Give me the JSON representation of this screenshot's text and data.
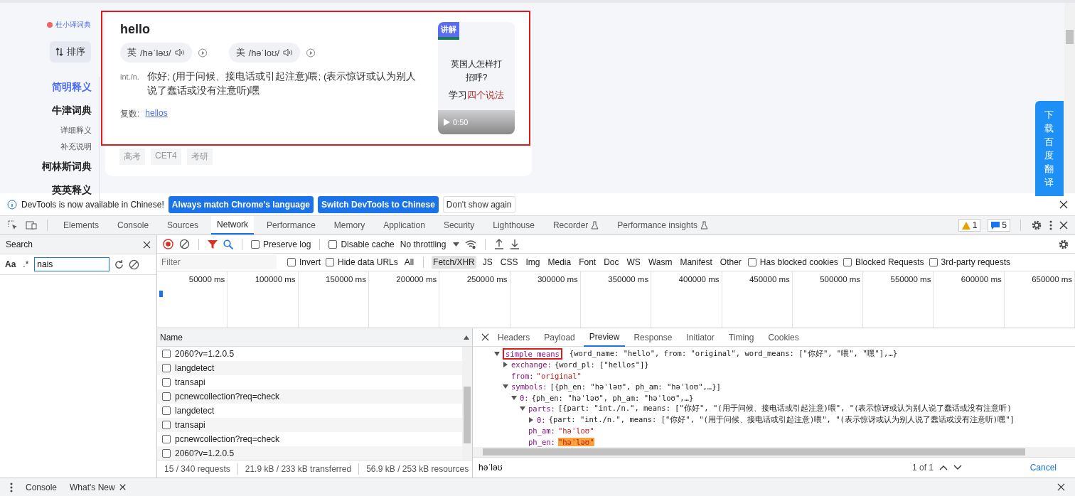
{
  "page": {
    "sidebar": {
      "logo_text": "杜小译词典",
      "sort_button": "排序",
      "nav": [
        {
          "label": "简明释义",
          "selected": true
        },
        {
          "label": "牛津词典",
          "selected": false,
          "children": [
            {
              "label": "详细释义",
              "selected": false
            },
            {
              "label": "补充说明",
              "selected": false
            }
          ]
        },
        {
          "label": "柯林斯词典",
          "selected": false
        },
        {
          "label": "英英释义",
          "selected": false
        }
      ]
    },
    "card": {
      "highlighted": true,
      "word": "hello",
      "pronunciations": [
        {
          "region": "英",
          "ipa": "/həˈləʊ/"
        },
        {
          "region": "美",
          "ipa": "/həˈloʊ/"
        }
      ],
      "definition": {
        "pos": "int./n.",
        "text": "你好;  (用于问候、接电话或引起注意)喂;  (表示惊讶或认为别人说了蠢话或没有注意听)嘿"
      },
      "plural_label": "复数:",
      "plural_link": "hellos",
      "video": {
        "badge": "讲解",
        "title": "英国人怎样打招呼?",
        "subtitle_prefix": "学习",
        "subtitle_highlight": "四个说法",
        "duration": "0:50"
      },
      "tags": [
        "高考",
        "CET4",
        "考研"
      ]
    },
    "download_banner": "下载百度翻译"
  },
  "devtools": {
    "infobar": {
      "message": "DevTools is now available in Chinese!",
      "buttons": [
        {
          "label": "Always match Chrome's language",
          "kind": "primary"
        },
        {
          "label": "Switch DevTools to Chinese",
          "kind": "primary"
        },
        {
          "label": "Don't show again",
          "kind": "plain"
        }
      ]
    },
    "tabs": [
      {
        "label": "Elements",
        "selected": false,
        "experimental": false
      },
      {
        "label": "Console",
        "selected": false,
        "experimental": false
      },
      {
        "label": "Sources",
        "selected": false,
        "experimental": false
      },
      {
        "label": "Network",
        "selected": true,
        "experimental": false
      },
      {
        "label": "Performance",
        "selected": false,
        "experimental": false
      },
      {
        "label": "Memory",
        "selected": false,
        "experimental": false
      },
      {
        "label": "Application",
        "selected": false,
        "experimental": false
      },
      {
        "label": "Security",
        "selected": false,
        "experimental": false
      },
      {
        "label": "Lighthouse",
        "selected": false,
        "experimental": false
      },
      {
        "label": "Recorder",
        "selected": false,
        "experimental": true
      },
      {
        "label": "Performance insights",
        "selected": false,
        "experimental": true
      }
    ],
    "warnings": "1",
    "messages": "5",
    "search_panel": {
      "title": "Search",
      "case_toggle": "Aa",
      "regex_toggle": ".*",
      "query": "nais"
    },
    "toolbar": {
      "preserve_log": false,
      "preserve_log_label": "Preserve log",
      "disable_cache": false,
      "disable_cache_label": "Disable cache",
      "throttling": "No throttling"
    },
    "filter": {
      "placeholder": "Filter",
      "options": [
        {
          "label": "Invert",
          "checked": false
        },
        {
          "label": "Hide data URLs",
          "checked": false
        }
      ],
      "types": [
        {
          "label": "All",
          "selected": false
        },
        {
          "label": "Fetch/XHR",
          "selected": true
        },
        {
          "label": "JS",
          "selected": false
        },
        {
          "label": "CSS",
          "selected": false
        },
        {
          "label": "Img",
          "selected": false
        },
        {
          "label": "Media",
          "selected": false
        },
        {
          "label": "Font",
          "selected": false
        },
        {
          "label": "Doc",
          "selected": false
        },
        {
          "label": "WS",
          "selected": false
        },
        {
          "label": "Wasm",
          "selected": false
        },
        {
          "label": "Manifest",
          "selected": false
        },
        {
          "label": "Other",
          "selected": false
        }
      ],
      "extra": [
        {
          "label": "Has blocked cookies",
          "checked": false
        },
        {
          "label": "Blocked Requests",
          "checked": false
        },
        {
          "label": "3rd-party requests",
          "checked": false
        }
      ]
    },
    "timeline_ticks": [
      "50000 ms",
      "100000 ms",
      "150000 ms",
      "200000 ms",
      "250000 ms",
      "300000 ms",
      "350000 ms",
      "400000 ms",
      "450000 ms",
      "500000 ms",
      "550000 ms",
      "600000 ms",
      "650000 ms"
    ],
    "requests": {
      "column": "Name",
      "rows": [
        {
          "name": "2060?v=1.2.0.5",
          "checked": false
        },
        {
          "name": "langdetect",
          "checked": false
        },
        {
          "name": "transapi",
          "checked": false
        },
        {
          "name": "pcnewcollection?req=check",
          "checked": false
        },
        {
          "name": "langdetect",
          "checked": false
        },
        {
          "name": "transapi",
          "checked": false
        },
        {
          "name": "pcnewcollection?req=check",
          "checked": false
        },
        {
          "name": "2060?v=1.2.0.5",
          "checked": false
        }
      ],
      "status": [
        "15 / 340 requests",
        "21.9 kB / 233 kB transferred",
        "56.9 kB / 253 kB resources"
      ]
    },
    "detail_tabs": [
      {
        "label": "Headers",
        "selected": false
      },
      {
        "label": "Payload",
        "selected": false
      },
      {
        "label": "Preview",
        "selected": true
      },
      {
        "label": "Response",
        "selected": false
      },
      {
        "label": "Initiator",
        "selected": false
      },
      {
        "label": "Timing",
        "selected": false
      },
      {
        "label": "Cookies",
        "selected": false
      }
    ],
    "preview": [
      {
        "key": "simple_means",
        "value": "{word_name: \"hello\", from: \"original\", word_means: [\"你好\", \"喂\", \"嘿\"],…}",
        "kind": "object",
        "expanded": true,
        "outlined": true,
        "match": false,
        "children": [
          {
            "key": "exchange:",
            "value": "{word_pl: [\"hellos\"]}",
            "kind": "object",
            "expanded": false,
            "outlined": false,
            "match": false
          },
          {
            "key": "from:",
            "value": "\"original\"",
            "kind": "string",
            "outlined": false,
            "match": false
          },
          {
            "key": "symbols:",
            "value": "[{ph_en: \"həˈləʊ\", ph_am: \"həˈloʊ\",…}]",
            "kind": "object",
            "expanded": true,
            "outlined": false,
            "match": false,
            "children": [
              {
                "key": "0:",
                "value": "{ph_en: \"həˈləʊ\", ph_am: \"həˈloʊ\",…}",
                "kind": "object",
                "expanded": true,
                "outlined": false,
                "match": false,
                "children": [
                  {
                    "key": "parts:",
                    "value": "[{part: \"int./n.\", means: [\"你好\", \"(用于问候、接电话或引起注意)喂\", \"(表示惊讶或认为别人说了蠢话或没有注意听)",
                    "kind": "object",
                    "expanded": true,
                    "outlined": false,
                    "match": false,
                    "children": [
                      {
                        "key": "0:",
                        "value": "{part: \"int./n.\", means: [\"你好\", \"(用于问候、接电话或引起注意)喂\", \"(表示惊讶或认为别人说了蠢话或没有注意听)嘿\"]",
                        "kind": "object",
                        "expanded": false,
                        "outlined": false,
                        "match": false
                      }
                    ]
                  },
                  {
                    "key": "ph_am:",
                    "value": "\"həˈloʊ\"",
                    "kind": "string",
                    "outlined": false,
                    "match": false
                  },
                  {
                    "key": "ph_en:",
                    "value": "\"həˈləʊ\"",
                    "kind": "string",
                    "outlined": false,
                    "match": true
                  }
                ]
              }
            ]
          }
        ]
      }
    ],
    "find_bar": {
      "query": "həˈləʊ",
      "count": "1 of 1",
      "cancel": "Cancel"
    },
    "drawer_tabs": [
      {
        "label": "Console",
        "closable": false
      },
      {
        "label": "What's New",
        "closable": true
      }
    ]
  }
}
